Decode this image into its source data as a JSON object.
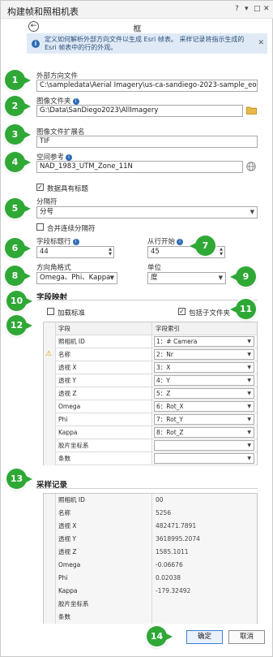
{
  "window": {
    "title": "构建帧和照相机表",
    "help": "?",
    "pin": "▾",
    "restore": "□",
    "close": "✕"
  },
  "tool_title": "框",
  "info_banner": {
    "text": "定义如何解析外部方向文件以生成 Esri 帧表。 采样记录将指示生成的 Esri 帧表中的行的外观。"
  },
  "fields": {
    "eo_file_label": "外部方向文件",
    "eo_file_value": "C:\\sampledata\\Aerial Imagery\\us-ca-sandiego-2023-sample_eo.txt",
    "image_folder_label": "图像文件夹",
    "image_folder_value": "G:\\Data\\SanDiego2023\\AllImagery",
    "image_ext_label": "图像文件扩展名",
    "image_ext_value": "TIF",
    "spatial_ref_label": "空间参考",
    "spatial_ref_value": "NAD_1983_UTM_Zone_11N",
    "has_header_label": "数据具有标题",
    "delimiter_label": "分隔符",
    "delimiter_value": "分号",
    "merge_delim_label": "合并连续分隔符",
    "header_row_label": "字段标题行",
    "header_row_value": "44",
    "start_row_label": "从行开始",
    "start_row_value": "45",
    "angle_format_label": "方向角格式",
    "angle_format_value": "Omega、Phi、Kappa",
    "units_label": "单位",
    "units_value": "度"
  },
  "field_map": {
    "heading": "字段映射",
    "load_standard": "加载标准",
    "include_subfolders": "包括子文件夹",
    "col_field": "字段",
    "col_index": "字段索引",
    "rows": [
      {
        "field": "照相机 ID",
        "index": "1：# Camera",
        "warn": false
      },
      {
        "field": "名称",
        "index": "2：Nr",
        "warn": true
      },
      {
        "field": "透视 X",
        "index": "3：X",
        "warn": false
      },
      {
        "field": "透视 Y",
        "index": "4：Y",
        "warn": false
      },
      {
        "field": "透视 Z",
        "index": "5：Z",
        "warn": false
      },
      {
        "field": "Omega",
        "index": "6：Rot_X",
        "warn": false
      },
      {
        "field": "Phi",
        "index": "7：Rot_Y",
        "warn": false
      },
      {
        "field": "Kappa",
        "index": "8：Rot_Z",
        "warn": false
      },
      {
        "field": "胶片坐标系",
        "index": "",
        "warn": false
      },
      {
        "field": "条数",
        "index": "",
        "warn": false
      }
    ]
  },
  "samples": {
    "heading": "采样记录",
    "rows": [
      {
        "field": "照相机 ID",
        "value": "00"
      },
      {
        "field": "名称",
        "value": "5256"
      },
      {
        "field": "透视 X",
        "value": "482471.7891"
      },
      {
        "field": "透视 Y",
        "value": "3618995.2074"
      },
      {
        "field": "透视 Z",
        "value": "1585.1011"
      },
      {
        "field": "Omega",
        "value": "-0.06676"
      },
      {
        "field": "Phi",
        "value": "0.02038"
      },
      {
        "field": "Kappa",
        "value": "-179.32492"
      },
      {
        "field": "胶片坐标系",
        "value": ""
      },
      {
        "field": "条数",
        "value": ""
      }
    ]
  },
  "buttons": {
    "ok": "确定",
    "cancel": "取消"
  },
  "markers": [
    "1",
    "2",
    "3",
    "4",
    "5",
    "6",
    "7",
    "8",
    "9",
    "10",
    "11",
    "12",
    "13",
    "14"
  ],
  "colors": {
    "marker_green": "#2fa836",
    "accent_blue": "#2d6cb5",
    "info_bg": "#dfeaf6"
  }
}
